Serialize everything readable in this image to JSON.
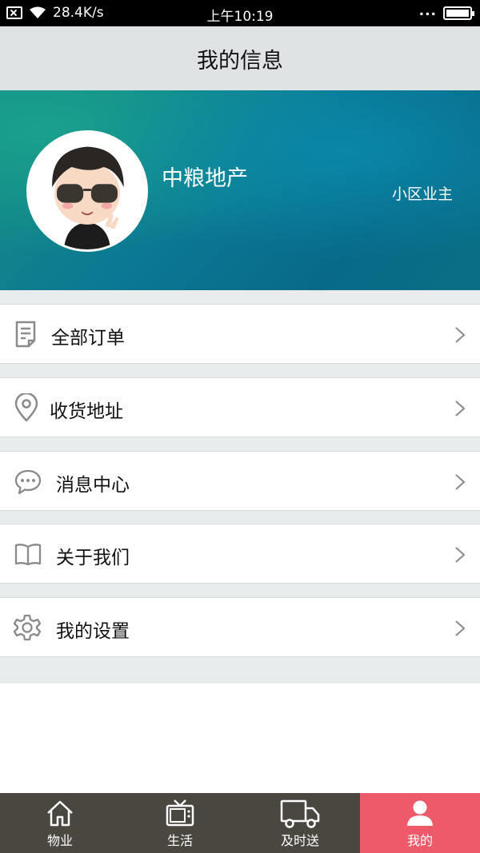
{
  "status_bar": {
    "network_speed": "28.4K/s",
    "time": "上午10:19",
    "more": "..."
  },
  "header": {
    "title": "我的信息"
  },
  "profile": {
    "name": "中粮地产",
    "role": "小区业主"
  },
  "menu": [
    {
      "label": "全部订单",
      "icon": "order-list-icon"
    },
    {
      "label": "收货地址",
      "icon": "location-pin-icon"
    },
    {
      "label": "消息中心",
      "icon": "chat-bubble-icon"
    },
    {
      "label": "关于我们",
      "icon": "book-icon"
    },
    {
      "label": "我的设置",
      "icon": "gear-icon"
    }
  ],
  "tabs": [
    {
      "label": "物业",
      "icon": "home-icon",
      "active": false
    },
    {
      "label": "生活",
      "icon": "tv-icon",
      "active": false
    },
    {
      "label": "及时送",
      "icon": "truck-icon",
      "active": false
    },
    {
      "label": "我的",
      "icon": "user-icon",
      "active": true
    }
  ],
  "colors": {
    "accent": "#ef5a6a",
    "tabbar": "#4a4640",
    "banner": "#0b7894"
  }
}
